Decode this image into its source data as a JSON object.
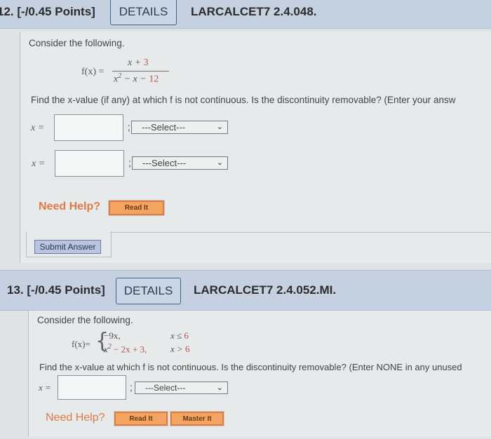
{
  "q12": {
    "number": "12.",
    "points": "[-/0.45 Points]",
    "details_label": "DETAILS",
    "code": "LARCALCET7 2.4.048.",
    "intro": "Consider the following.",
    "func_label": "f(x) =",
    "numerator": {
      "var": "x + ",
      "const": "3"
    },
    "denominator": {
      "var": "x",
      "exp": "2",
      "mid": " − x − ",
      "const": "12"
    },
    "prompt": "Find the x-value (if any) at which f is not continuous. Is the discontinuity removable? (Enter your answ",
    "answers": [
      {
        "label": "x =",
        "value": "",
        "select": "---Select---"
      },
      {
        "label": "x =",
        "value": "",
        "select": "---Select---"
      }
    ],
    "need_help": "Need Help?",
    "read_it": "Read It",
    "submit": "Submit Answer"
  },
  "q13": {
    "number": "13.",
    "points": "[-/0.45 Points]",
    "details_label": "DETAILS",
    "code": "LARCALCET7 2.4.052.MI.",
    "intro": "Consider the following.",
    "func_label": "f(x)=",
    "piece1": {
      "expr": "−9x,",
      "cond": "x ≤ ",
      "bound": "6"
    },
    "piece2": {
      "var": "x",
      "exp": "2",
      "rest": " − 2x + 3,",
      "cond": "x > ",
      "bound": "6"
    },
    "prompt": "Find the x-value at which f is not continuous. Is the discontinuity removable? (Enter NONE in any unused",
    "answer": {
      "label": "x =",
      "value": "",
      "select": "---Select---"
    },
    "need_help": "Need Help?",
    "read_it": "Read It",
    "master_it": "Master It"
  }
}
